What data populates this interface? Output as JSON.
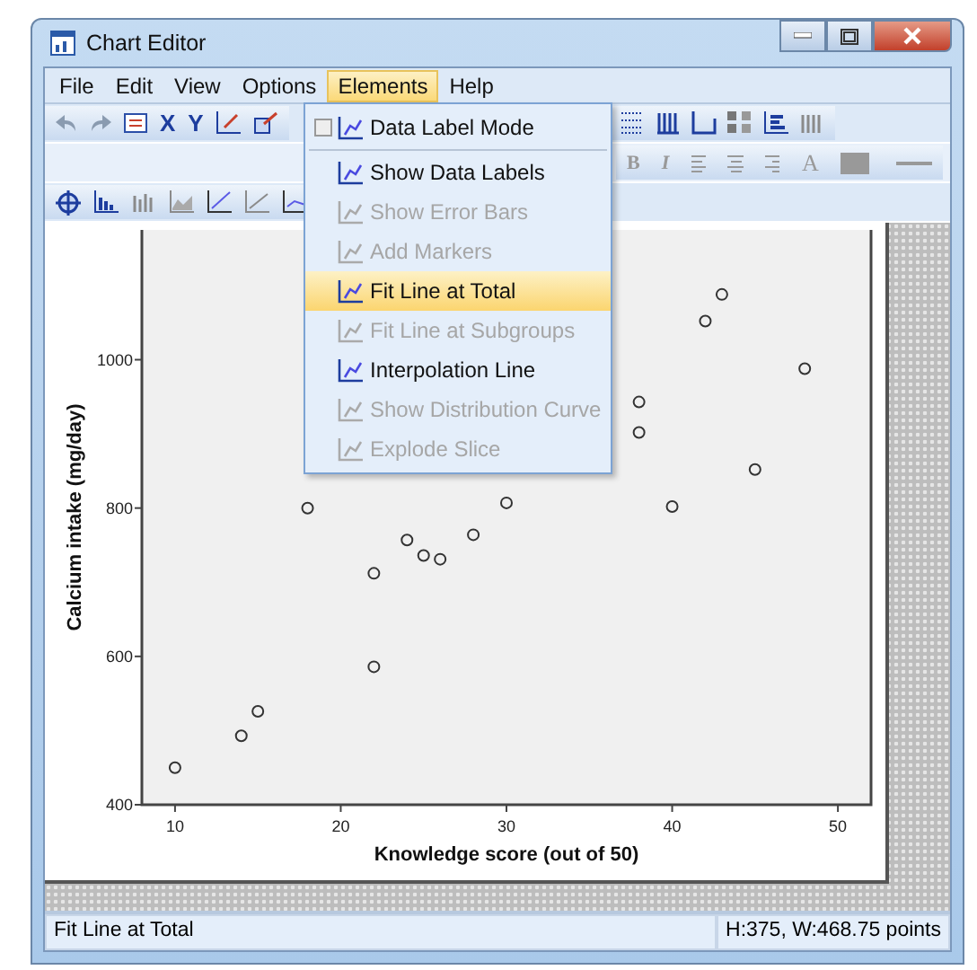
{
  "window": {
    "title": "Chart Editor"
  },
  "menu_bar": [
    {
      "label": "File",
      "selected": false
    },
    {
      "label": "Edit",
      "selected": false
    },
    {
      "label": "View",
      "selected": false
    },
    {
      "label": "Options",
      "selected": false
    },
    {
      "label": "Elements",
      "selected": true
    },
    {
      "label": "Help",
      "selected": false
    }
  ],
  "toolbar": {
    "axis_buttons": [
      "X",
      "Y"
    ],
    "format_buttons": [
      "B",
      "I"
    ],
    "font_button": "A"
  },
  "elements_menu": [
    {
      "label": "Data Label Mode",
      "kind": "checkbox",
      "checked": false,
      "disabled": false,
      "selected": false,
      "separator_after": true
    },
    {
      "label": "Show Data Labels",
      "kind": "item",
      "disabled": false,
      "selected": false,
      "separator_after": false
    },
    {
      "label": "Show Error Bars",
      "kind": "item",
      "disabled": true,
      "selected": false,
      "separator_after": false
    },
    {
      "label": "Add Markers",
      "kind": "item",
      "disabled": true,
      "selected": false,
      "separator_after": false
    },
    {
      "label": "Fit Line at Total",
      "kind": "item",
      "disabled": false,
      "selected": true,
      "separator_after": false
    },
    {
      "label": "Fit Line at Subgroups",
      "kind": "item",
      "disabled": true,
      "selected": false,
      "separator_after": false
    },
    {
      "label": "Interpolation Line",
      "kind": "item",
      "disabled": false,
      "selected": false,
      "separator_after": false
    },
    {
      "label": "Show Distribution Curve",
      "kind": "item",
      "disabled": true,
      "selected": false,
      "separator_after": false
    },
    {
      "label": "Explode Slice",
      "kind": "item",
      "disabled": true,
      "selected": false,
      "separator_after": false
    }
  ],
  "chart": {
    "chart_data": {
      "type": "scatter",
      "xlabel": "Knowledge score (out of 50)",
      "ylabel": "Calcium intake (mg/day)",
      "xlim": [
        8,
        52
      ],
      "ylim": [
        400,
        1175
      ],
      "xticks": [
        10,
        20,
        30,
        40,
        50
      ],
      "yticks": [
        400,
        600,
        800,
        1000
      ],
      "series": [
        {
          "color": "#333333",
          "x": [
            10,
            14,
            15,
            18,
            22,
            22,
            24,
            25,
            26,
            28,
            30,
            32,
            38,
            38,
            40,
            42,
            43,
            45,
            48
          ],
          "values": [
            450,
            493,
            526,
            800,
            712,
            586,
            757,
            736,
            731,
            764,
            807,
            null,
            943,
            902,
            802,
            1052,
            1088,
            852,
            988
          ]
        }
      ]
    }
  },
  "status_bar": {
    "message": "Fit Line at Total",
    "size": "H:375, W:468.75 points"
  }
}
